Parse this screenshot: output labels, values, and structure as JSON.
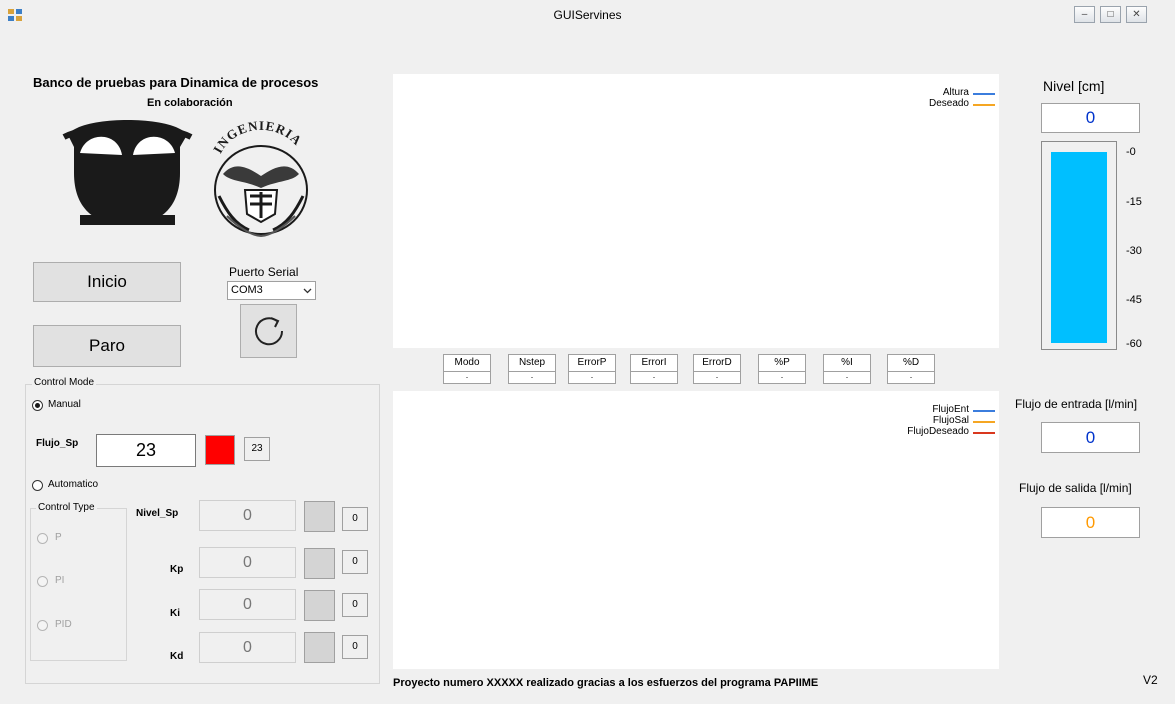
{
  "window": {
    "title": "GUIServines",
    "minimize_glyph": "–",
    "maximize_glyph": "□",
    "close_glyph": "✕"
  },
  "header": {
    "title": "Banco de pruebas para Dinamica de procesos",
    "subtitle": "En colaboración",
    "logo_right_text": "INGENIERIA"
  },
  "controls": {
    "start_label": "Inicio",
    "stop_label": "Paro",
    "serial_label": "Puerto Serial",
    "serial_value": "COM3",
    "refresh_icon": "refresh-icon"
  },
  "control_mode": {
    "group_label": "Control Mode",
    "manual_label": "Manual",
    "manual_selected": true,
    "flujo_sp_label": "Flujo_Sp",
    "flujo_sp_value": "23",
    "flujo_sp_echo": "23",
    "flujo_swatch_color": "#ff0000",
    "automatico_label": "Automatico",
    "control_type_label": "Control Type",
    "control_types": [
      "P",
      "PI",
      "PID"
    ],
    "params": [
      {
        "label": "Nivel_Sp",
        "value": "0",
        "echo": "0"
      },
      {
        "label": "Kp",
        "value": "0",
        "echo": "0"
      },
      {
        "label": "Ki",
        "value": "0",
        "echo": "0"
      },
      {
        "label": "Kd",
        "value": "0",
        "echo": "0"
      }
    ]
  },
  "plots": {
    "top_legend": [
      {
        "label": "Altura",
        "color": "#3b7ddd"
      },
      {
        "label": "Deseado",
        "color": "#f5a623"
      }
    ],
    "bottom_legend": [
      {
        "label": "FlujoEnt",
        "color": "#3b7ddd"
      },
      {
        "label": "FlujoSal",
        "color": "#f5a623"
      },
      {
        "label": "FlujoDeseado",
        "color": "#d9381e"
      }
    ]
  },
  "status": [
    {
      "header": "Modo",
      "value": "."
    },
    {
      "header": "Nstep",
      "value": "."
    },
    {
      "header": "ErrorP",
      "value": "."
    },
    {
      "header": "ErrorI",
      "value": "."
    },
    {
      "header": "ErrorD",
      "value": "."
    },
    {
      "header": "%P",
      "value": "."
    },
    {
      "header": "%I",
      "value": "."
    },
    {
      "header": "%D",
      "value": "."
    }
  ],
  "level": {
    "label": "Nivel [cm]",
    "value": "0",
    "bar_color": "#00bfff",
    "bar_fill_fraction": 1.0,
    "scale": [
      "-0",
      "-15",
      "-30",
      "-45",
      "-60"
    ]
  },
  "flows": {
    "in_label": "Flujo de entrada [l/min]",
    "in_value": "0",
    "out_label": "Flujo de salida [l/min]",
    "out_value": "0",
    "out_color": "#ff9900"
  },
  "footer": {
    "text": "Proyecto numero XXXXX realizado gracias a los esfuerzos del programa PAPIIME",
    "version": "V2"
  }
}
